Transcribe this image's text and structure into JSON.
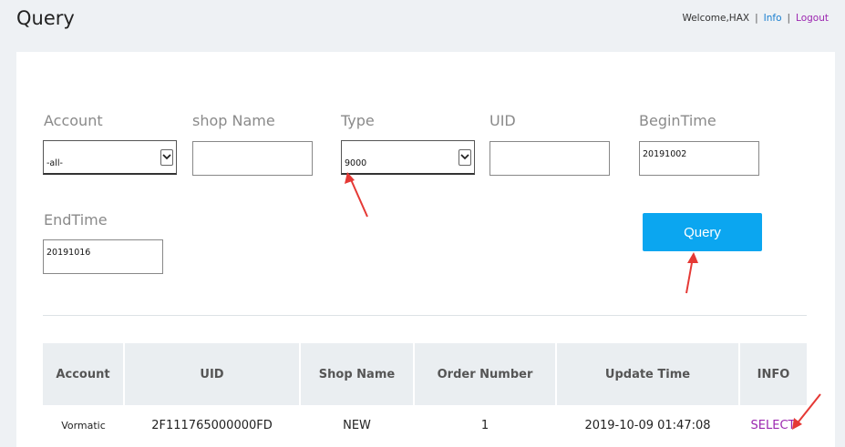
{
  "header": {
    "title": "Query",
    "welcome": "Welcome,HAX",
    "separator": "|",
    "info_link": "Info",
    "logout_link": "Logout"
  },
  "form": {
    "account": {
      "label": "Account",
      "value": "-all-"
    },
    "shop_name": {
      "label": "shop Name",
      "value": ""
    },
    "type": {
      "label": "Type",
      "value": "9000"
    },
    "uid": {
      "label": "UID",
      "value": ""
    },
    "begin_time": {
      "label": "BeginTime",
      "value": "20191002"
    },
    "end_time": {
      "label": "EndTime",
      "value": "20191016"
    },
    "query_button": "Query"
  },
  "table": {
    "columns": [
      "Account",
      "UID",
      "Shop Name",
      "Order Number",
      "Update Time",
      "INFO"
    ],
    "rows": [
      {
        "account": "Vormatic",
        "uid": "2F111765000000FD",
        "shop_name": "NEW",
        "order_number": "1",
        "update_time": "2019-10-09 01:47:08",
        "info": "SELECT"
      }
    ]
  },
  "colors": {
    "accent": "#0ba6f0",
    "link_blue": "#1a7fd0",
    "link_purple": "#9c27b0",
    "annotation_arrow": "#e53935"
  }
}
